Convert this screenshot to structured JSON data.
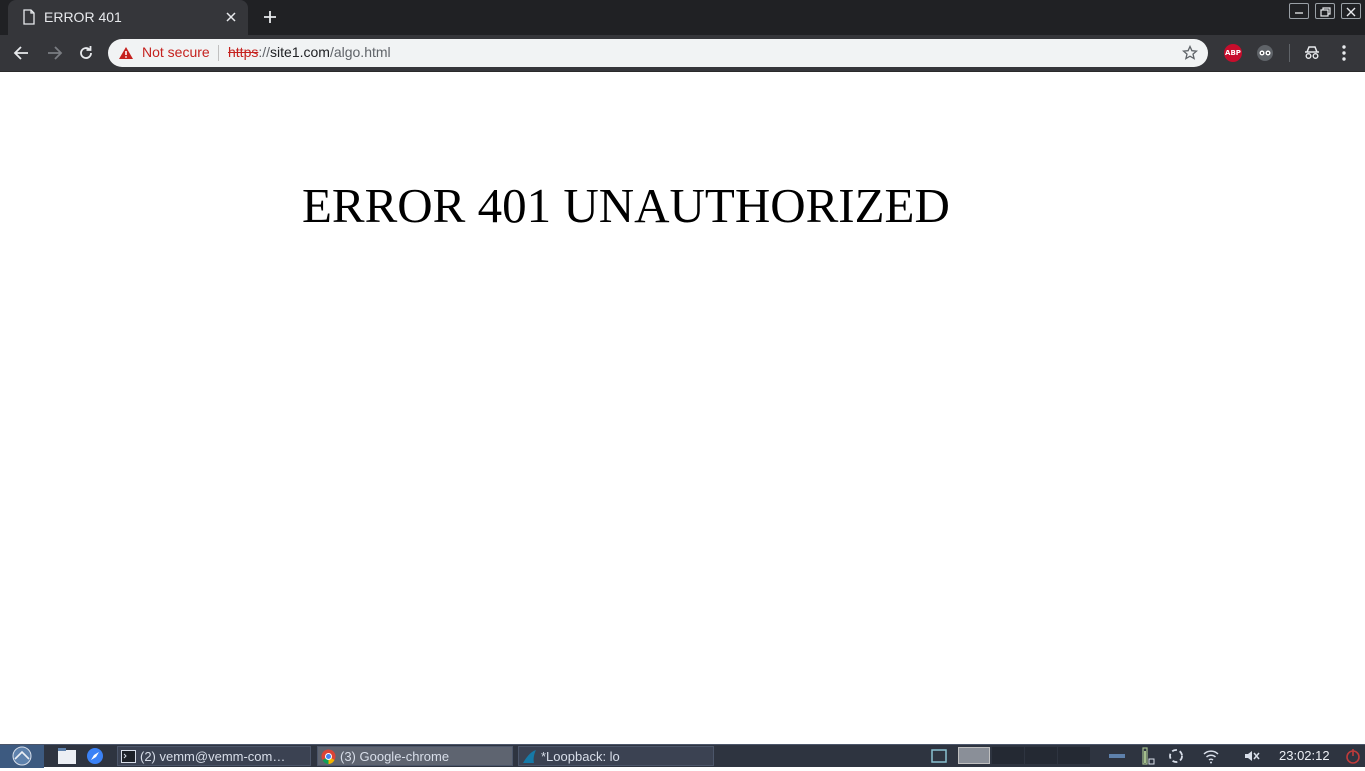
{
  "browser": {
    "tab": {
      "title": "ERROR 401"
    },
    "omnibox": {
      "security_label": "Not secure",
      "url_scheme": "https",
      "url_separator": "://",
      "url_host": "site1.com",
      "url_path": "/algo.html"
    },
    "extensions": {
      "abp_label": "ABP"
    }
  },
  "page": {
    "heading": "ERROR 401 UNAUTHORIZED"
  },
  "taskbar": {
    "tasks": [
      {
        "label": "(2) vemm@vemm-com…",
        "icon": "terminal-icon"
      },
      {
        "label": "(3) Google-chrome",
        "icon": "chrome-icon"
      },
      {
        "label": "*Loopback: lo",
        "icon": "wireshark-icon"
      }
    ],
    "clock": "23:02:12"
  },
  "colors": {
    "tab_strip": "#202124",
    "toolbar": "#35363a",
    "not_secure_red": "#c5221f",
    "taskbar": "#2e3440"
  }
}
